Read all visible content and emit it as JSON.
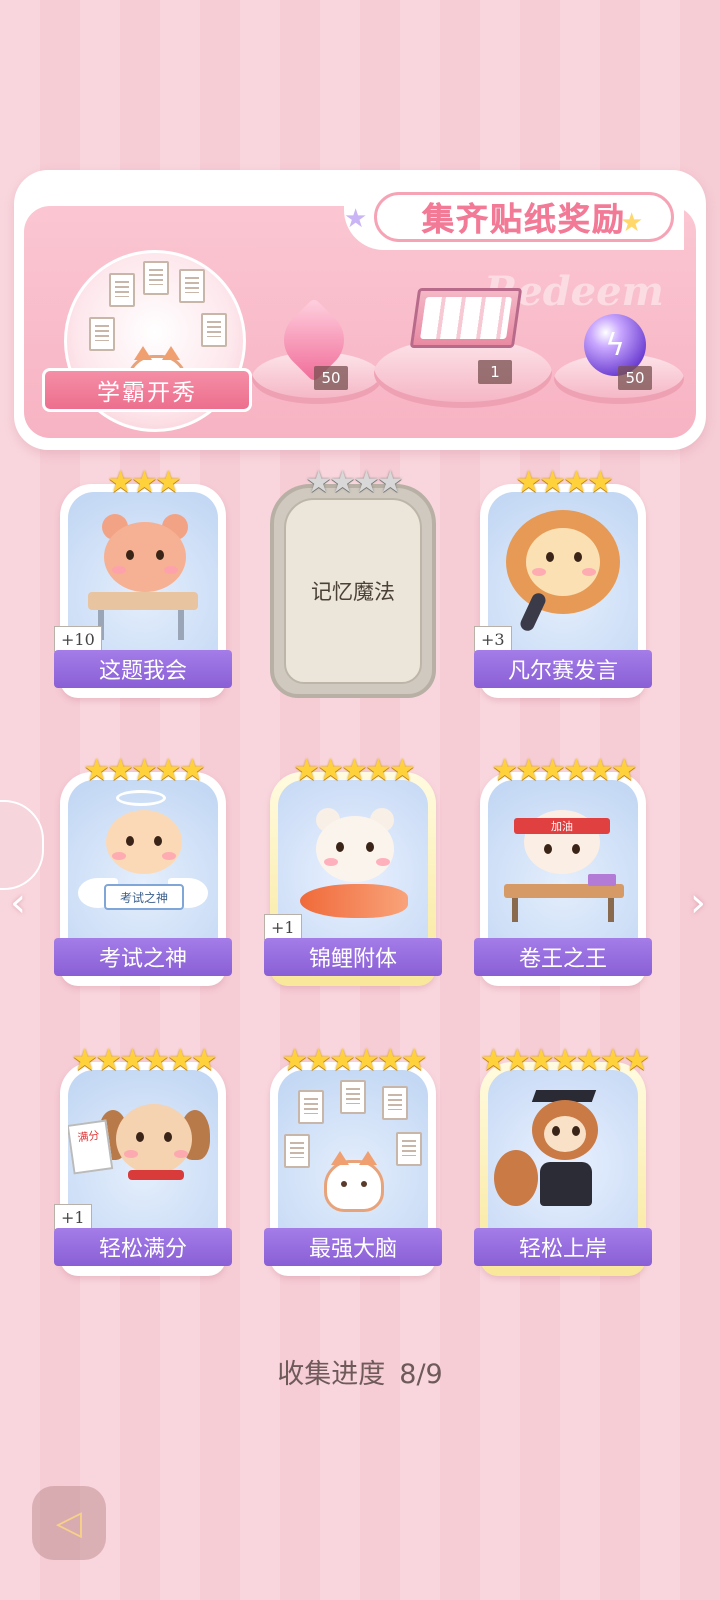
{
  "banner": {
    "title": "集齐贴纸奖励",
    "watermark": "Redeem",
    "showcase_label": "学霸开秀",
    "rewards": [
      {
        "icon": "pink-heart-gem-icon",
        "count": "50"
      },
      {
        "icon": "gift-box-icon",
        "count": "1"
      },
      {
        "icon": "purple-energy-orb-icon",
        "count": "50"
      }
    ]
  },
  "stickers": [
    {
      "label": "这题我会",
      "stars": "★★★",
      "badge": "+10",
      "character": "bear-at-desk",
      "locked": false
    },
    {
      "label": "记忆魔法",
      "stars": "★★★★",
      "badge": "",
      "character": "",
      "locked": true
    },
    {
      "label": "凡尔赛发言",
      "stars": "★★★★",
      "badge": "+3",
      "character": "lion-with-microphone",
      "locked": false
    },
    {
      "label": "考试之神",
      "stars": "★★★★★",
      "badge": "",
      "character": "angel-cat",
      "locked": false,
      "sign": "考试之神"
    },
    {
      "label": "锦鲤附体",
      "stars": "★★★★★",
      "badge": "+1",
      "character": "polar-bear-with-koi",
      "locked": false
    },
    {
      "label": "卷王之王",
      "stars": "★★★★★★",
      "badge": "",
      "character": "cat-studying",
      "locked": false,
      "headband": "加油"
    },
    {
      "label": "轻松满分",
      "stars": "★★★★★★",
      "badge": "+1",
      "character": "puppy-with-test",
      "locked": false,
      "paper": "满分"
    },
    {
      "label": "最强大脑",
      "stars": "★★★★★★",
      "badge": "",
      "character": "cat-with-papers",
      "locked": false
    },
    {
      "label": "轻松上岸",
      "stars": "★★★★★★★",
      "badge": "",
      "character": "squirrel-graduate",
      "locked": false
    }
  ],
  "progress": {
    "label": "收集进度",
    "value": "8/9"
  },
  "nav": {
    "prev": "‹",
    "next": "›",
    "back": "◁"
  },
  "colors": {
    "accent": "#f27a97",
    "label_bar": "#9a6fe0",
    "background": "#f9d6dd"
  }
}
